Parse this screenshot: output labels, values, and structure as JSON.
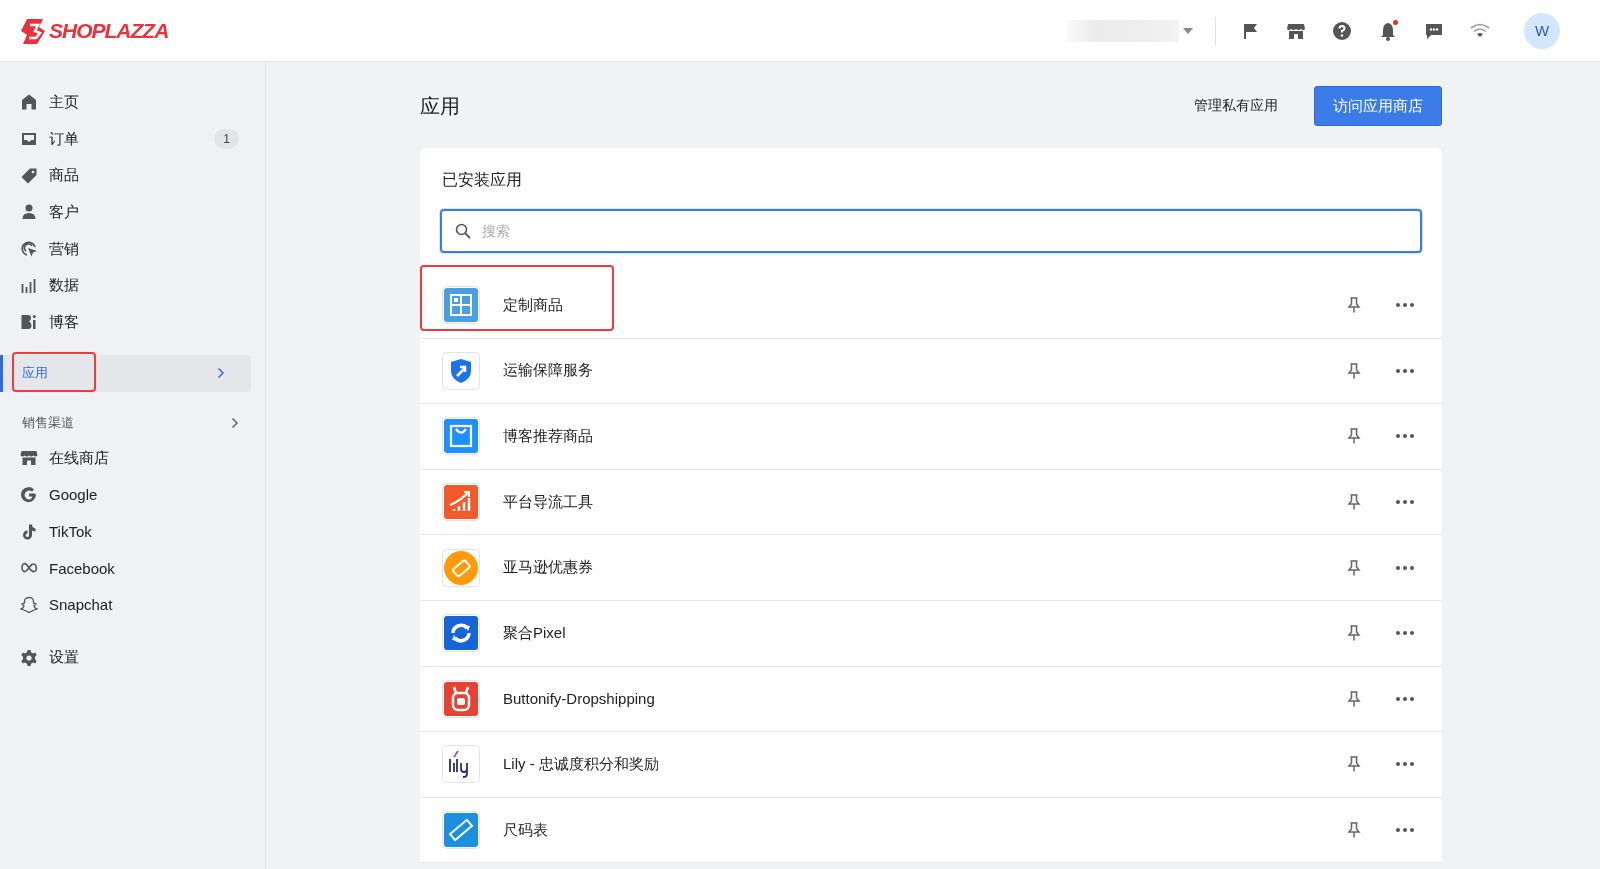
{
  "header": {
    "logo": "SHOPLAZZA",
    "notifications": {
      "unread": true
    },
    "avatar": "W"
  },
  "sidebar": {
    "items": [
      {
        "label": "主页",
        "selected": false
      },
      {
        "label": "订单",
        "selected": false,
        "badge": "1"
      },
      {
        "label": "商品",
        "selected": false
      },
      {
        "label": "客户",
        "selected": false
      },
      {
        "label": "营销",
        "selected": false
      },
      {
        "label": "数据",
        "selected": false
      },
      {
        "label": "博客",
        "selected": false
      }
    ],
    "apps": {
      "label": "应用",
      "selected": true,
      "highlighted": true
    },
    "channels_heading": "销售渠道",
    "channels": [
      {
        "label": "在线商店"
      },
      {
        "label": "Google"
      },
      {
        "label": "TikTok"
      },
      {
        "label": "Facebook"
      },
      {
        "label": "Snapchat"
      }
    ],
    "settings": {
      "label": "设置"
    }
  },
  "page": {
    "title": "应用",
    "secondary_action": "管理私有应用",
    "primary_action": "访问应用商店"
  },
  "installed": {
    "title": "已安装应用",
    "search": {
      "placeholder": "搜索"
    },
    "apps": [
      {
        "name": "定制商品",
        "highlighted": true
      },
      {
        "name": "运输保障服务",
        "highlighted": false
      },
      {
        "name": "博客推荐商品",
        "highlighted": false
      },
      {
        "name": "平台导流工具",
        "highlighted": false
      },
      {
        "name": "亚马逊优惠券",
        "highlighted": false
      },
      {
        "name": "聚合Pixel",
        "highlighted": false
      },
      {
        "name": "Buttonify-Dropshipping",
        "highlighted": false
      },
      {
        "name": "Lily - 忠诚度积分和奖励",
        "highlighted": false
      },
      {
        "name": "尺码表",
        "highlighted": false
      }
    ]
  }
}
